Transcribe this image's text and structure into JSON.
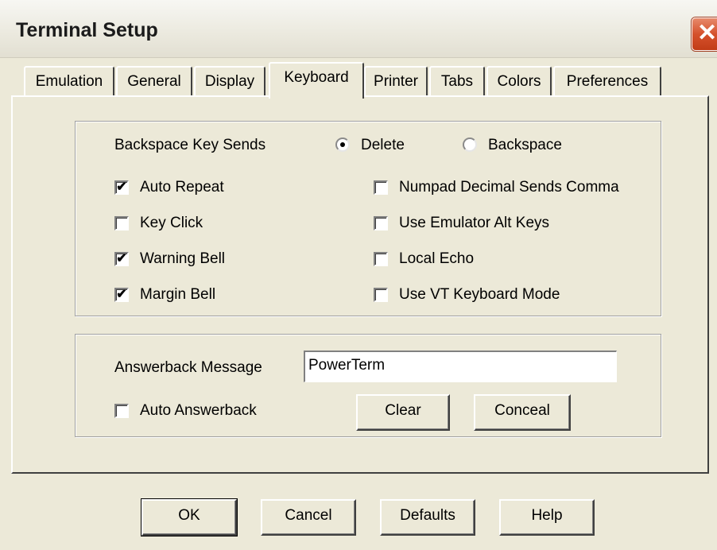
{
  "window": {
    "title": "Terminal Setup",
    "close_glyph": "✕"
  },
  "tabs": [
    "Emulation",
    "General",
    "Display",
    "Keyboard",
    "Printer",
    "Tabs",
    "Colors",
    "Preferences"
  ],
  "active_tab": "Keyboard",
  "keyboard": {
    "backspace_label": "Backspace Key Sends",
    "backspace_options": [
      {
        "label": "Delete",
        "selected": true
      },
      {
        "label": "Backspace",
        "selected": false
      }
    ],
    "checkboxes_left": [
      {
        "label": "Auto Repeat",
        "checked": true
      },
      {
        "label": "Key Click",
        "checked": false
      },
      {
        "label": "Warning Bell",
        "checked": true
      },
      {
        "label": "Margin Bell",
        "checked": true
      }
    ],
    "checkboxes_right": [
      {
        "label": "Numpad Decimal Sends Comma",
        "checked": false
      },
      {
        "label": "Use Emulator Alt Keys",
        "checked": false
      },
      {
        "label": "Local Echo",
        "checked": false
      },
      {
        "label": "Use VT Keyboard Mode",
        "checked": false
      }
    ],
    "check_glyph": "✔"
  },
  "answerback": {
    "label": "Answerback Message",
    "value": "PowerTerm",
    "auto_label": "Auto Answerback",
    "auto_checked": false,
    "clear_label": "Clear",
    "conceal_label": "Conceal"
  },
  "footer": {
    "ok": "OK",
    "cancel": "Cancel",
    "defaults": "Defaults",
    "help": "Help"
  }
}
